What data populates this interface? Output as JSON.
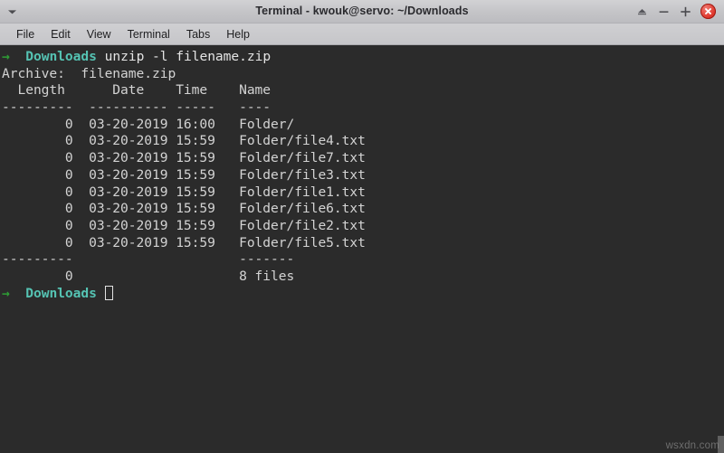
{
  "window": {
    "title": "Terminal - kwouk@servo: ~/Downloads",
    "menu_arrow_icon": "chevron-down-icon",
    "buttons": {
      "shade_icon": "shade-window-icon",
      "minimize_icon": "minimize-icon",
      "maximize_icon": "maximize-plus-icon",
      "close_icon": "close-icon"
    }
  },
  "menubar": {
    "items": [
      {
        "label": "File"
      },
      {
        "label": "Edit"
      },
      {
        "label": "View"
      },
      {
        "label": "Terminal"
      },
      {
        "label": "Tabs"
      },
      {
        "label": "Help"
      }
    ]
  },
  "terminal": {
    "colors": {
      "background": "#2b2b2b",
      "foreground": "#d5d5d5",
      "prompt_arrow": "#2e9e35",
      "prompt_cwd": "#55c3b3"
    },
    "prompt": {
      "arrow": "→",
      "cwd": "Downloads"
    },
    "command": "unzip -l filename.zip",
    "lines": [
      "Archive:  filename.zip",
      "  Length      Date    Time    Name",
      "---------  ---------- -----   ----",
      "        0  03-20-2019 16:00   Folder/",
      "        0  03-20-2019 15:59   Folder/file4.txt",
      "        0  03-20-2019 15:59   Folder/file7.txt",
      "        0  03-20-2019 15:59   Folder/file3.txt",
      "        0  03-20-2019 15:59   Folder/file1.txt",
      "        0  03-20-2019 15:59   Folder/file6.txt",
      "        0  03-20-2019 15:59   Folder/file2.txt",
      "        0  03-20-2019 15:59   Folder/file5.txt",
      "---------                     -------",
      "        0                     8 files"
    ],
    "archive_name": "filename.zip",
    "file_count": "8 files",
    "total_length": "0",
    "columns": [
      "Length",
      "Date",
      "Time",
      "Name"
    ],
    "entries": [
      {
        "length": "0",
        "date": "03-20-2019",
        "time": "16:00",
        "name": "Folder/"
      },
      {
        "length": "0",
        "date": "03-20-2019",
        "time": "15:59",
        "name": "Folder/file4.txt"
      },
      {
        "length": "0",
        "date": "03-20-2019",
        "time": "15:59",
        "name": "Folder/file7.txt"
      },
      {
        "length": "0",
        "date": "03-20-2019",
        "time": "15:59",
        "name": "Folder/file3.txt"
      },
      {
        "length": "0",
        "date": "03-20-2019",
        "time": "15:59",
        "name": "Folder/file1.txt"
      },
      {
        "length": "0",
        "date": "03-20-2019",
        "time": "15:59",
        "name": "Folder/file6.txt"
      },
      {
        "length": "0",
        "date": "03-20-2019",
        "time": "15:59",
        "name": "Folder/file2.txt"
      },
      {
        "length": "0",
        "date": "03-20-2019",
        "time": "15:59",
        "name": "Folder/file5.txt"
      }
    ]
  },
  "watermark": {
    "text": "wsxdn.com"
  }
}
